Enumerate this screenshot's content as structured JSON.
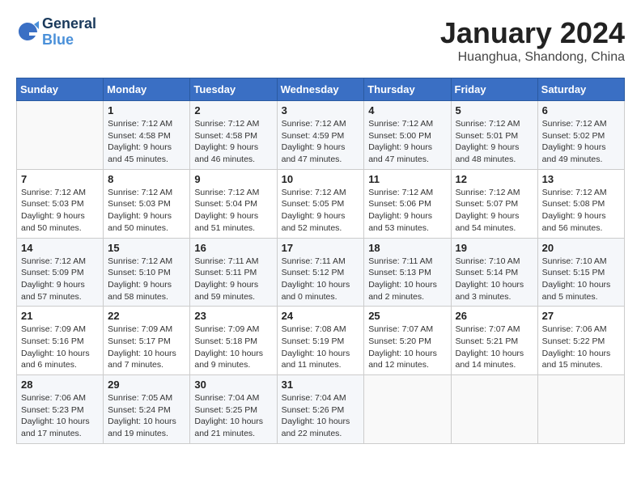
{
  "header": {
    "logo_line1": "General",
    "logo_line2": "Blue",
    "main_title": "January 2024",
    "subtitle": "Huanghua, Shandong, China"
  },
  "calendar": {
    "days_of_week": [
      "Sunday",
      "Monday",
      "Tuesday",
      "Wednesday",
      "Thursday",
      "Friday",
      "Saturday"
    ],
    "weeks": [
      [
        {
          "day": "",
          "info": ""
        },
        {
          "day": "1",
          "info": "Sunrise: 7:12 AM\nSunset: 4:58 PM\nDaylight: 9 hours\nand 45 minutes."
        },
        {
          "day": "2",
          "info": "Sunrise: 7:12 AM\nSunset: 4:58 PM\nDaylight: 9 hours\nand 46 minutes."
        },
        {
          "day": "3",
          "info": "Sunrise: 7:12 AM\nSunset: 4:59 PM\nDaylight: 9 hours\nand 47 minutes."
        },
        {
          "day": "4",
          "info": "Sunrise: 7:12 AM\nSunset: 5:00 PM\nDaylight: 9 hours\nand 47 minutes."
        },
        {
          "day": "5",
          "info": "Sunrise: 7:12 AM\nSunset: 5:01 PM\nDaylight: 9 hours\nand 48 minutes."
        },
        {
          "day": "6",
          "info": "Sunrise: 7:12 AM\nSunset: 5:02 PM\nDaylight: 9 hours\nand 49 minutes."
        }
      ],
      [
        {
          "day": "7",
          "info": "Sunrise: 7:12 AM\nSunset: 5:03 PM\nDaylight: 9 hours\nand 50 minutes."
        },
        {
          "day": "8",
          "info": "Sunrise: 7:12 AM\nSunset: 5:03 PM\nDaylight: 9 hours\nand 50 minutes."
        },
        {
          "day": "9",
          "info": "Sunrise: 7:12 AM\nSunset: 5:04 PM\nDaylight: 9 hours\nand 51 minutes."
        },
        {
          "day": "10",
          "info": "Sunrise: 7:12 AM\nSunset: 5:05 PM\nDaylight: 9 hours\nand 52 minutes."
        },
        {
          "day": "11",
          "info": "Sunrise: 7:12 AM\nSunset: 5:06 PM\nDaylight: 9 hours\nand 53 minutes."
        },
        {
          "day": "12",
          "info": "Sunrise: 7:12 AM\nSunset: 5:07 PM\nDaylight: 9 hours\nand 54 minutes."
        },
        {
          "day": "13",
          "info": "Sunrise: 7:12 AM\nSunset: 5:08 PM\nDaylight: 9 hours\nand 56 minutes."
        }
      ],
      [
        {
          "day": "14",
          "info": "Sunrise: 7:12 AM\nSunset: 5:09 PM\nDaylight: 9 hours\nand 57 minutes."
        },
        {
          "day": "15",
          "info": "Sunrise: 7:12 AM\nSunset: 5:10 PM\nDaylight: 9 hours\nand 58 minutes."
        },
        {
          "day": "16",
          "info": "Sunrise: 7:11 AM\nSunset: 5:11 PM\nDaylight: 9 hours\nand 59 minutes."
        },
        {
          "day": "17",
          "info": "Sunrise: 7:11 AM\nSunset: 5:12 PM\nDaylight: 10 hours\nand 0 minutes."
        },
        {
          "day": "18",
          "info": "Sunrise: 7:11 AM\nSunset: 5:13 PM\nDaylight: 10 hours\nand 2 minutes."
        },
        {
          "day": "19",
          "info": "Sunrise: 7:10 AM\nSunset: 5:14 PM\nDaylight: 10 hours\nand 3 minutes."
        },
        {
          "day": "20",
          "info": "Sunrise: 7:10 AM\nSunset: 5:15 PM\nDaylight: 10 hours\nand 5 minutes."
        }
      ],
      [
        {
          "day": "21",
          "info": "Sunrise: 7:09 AM\nSunset: 5:16 PM\nDaylight: 10 hours\nand 6 minutes."
        },
        {
          "day": "22",
          "info": "Sunrise: 7:09 AM\nSunset: 5:17 PM\nDaylight: 10 hours\nand 7 minutes."
        },
        {
          "day": "23",
          "info": "Sunrise: 7:09 AM\nSunset: 5:18 PM\nDaylight: 10 hours\nand 9 minutes."
        },
        {
          "day": "24",
          "info": "Sunrise: 7:08 AM\nSunset: 5:19 PM\nDaylight: 10 hours\nand 11 minutes."
        },
        {
          "day": "25",
          "info": "Sunrise: 7:07 AM\nSunset: 5:20 PM\nDaylight: 10 hours\nand 12 minutes."
        },
        {
          "day": "26",
          "info": "Sunrise: 7:07 AM\nSunset: 5:21 PM\nDaylight: 10 hours\nand 14 minutes."
        },
        {
          "day": "27",
          "info": "Sunrise: 7:06 AM\nSunset: 5:22 PM\nDaylight: 10 hours\nand 15 minutes."
        }
      ],
      [
        {
          "day": "28",
          "info": "Sunrise: 7:06 AM\nSunset: 5:23 PM\nDaylight: 10 hours\nand 17 minutes."
        },
        {
          "day": "29",
          "info": "Sunrise: 7:05 AM\nSunset: 5:24 PM\nDaylight: 10 hours\nand 19 minutes."
        },
        {
          "day": "30",
          "info": "Sunrise: 7:04 AM\nSunset: 5:25 PM\nDaylight: 10 hours\nand 21 minutes."
        },
        {
          "day": "31",
          "info": "Sunrise: 7:04 AM\nSunset: 5:26 PM\nDaylight: 10 hours\nand 22 minutes."
        },
        {
          "day": "",
          "info": ""
        },
        {
          "day": "",
          "info": ""
        },
        {
          "day": "",
          "info": ""
        }
      ]
    ]
  }
}
